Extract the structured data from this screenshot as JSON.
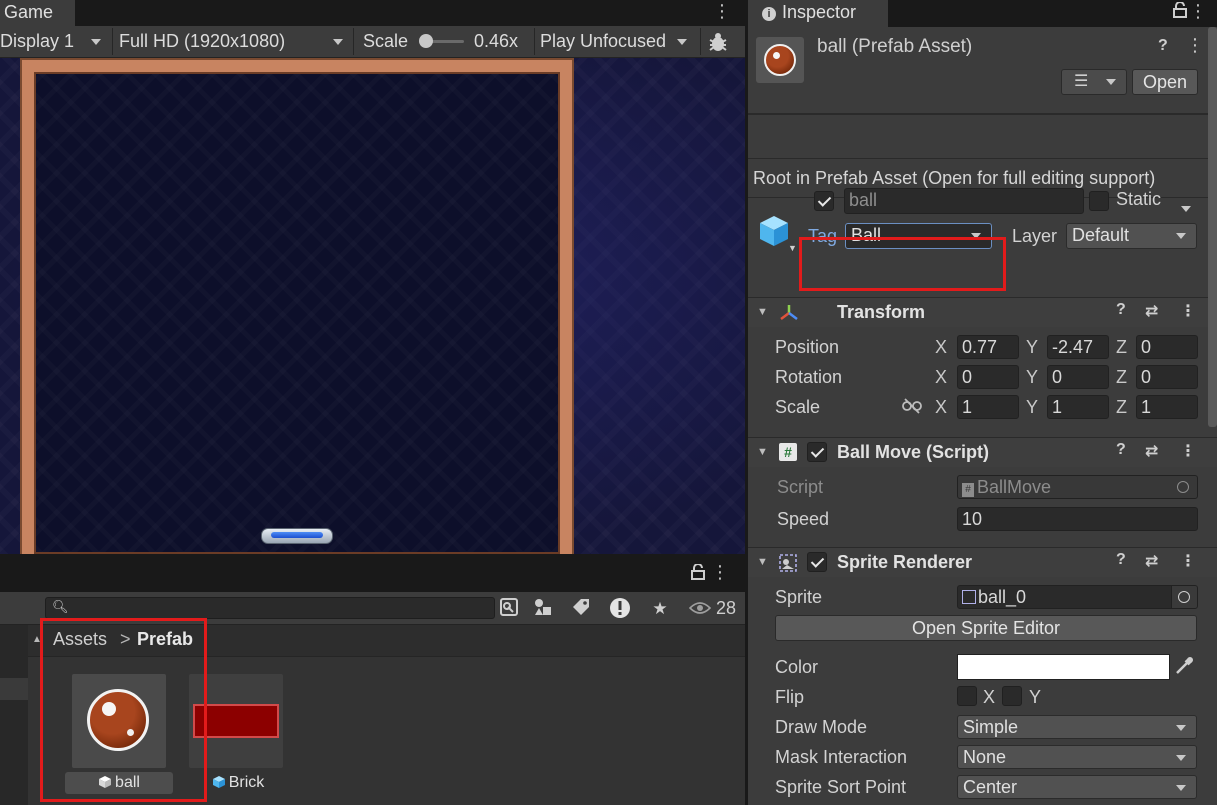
{
  "game": {
    "tab_label": "Game",
    "menu_icon": "kebab-menu-icon",
    "toolbar": {
      "display": "Display 1",
      "resolution": "Full HD (1920x1080)",
      "scale_label": "Scale",
      "scale_value": "0.46x",
      "play_mode": "Play Unfocused",
      "debug_icon": "bug-icon"
    }
  },
  "project": {
    "hidden_count": "28",
    "search_value": "",
    "breadcrumb": {
      "root": "Assets",
      "separator": ">",
      "current": "Prefab"
    },
    "assets": [
      {
        "name": "ball",
        "icon": "prefab-cube-icon"
      },
      {
        "name": "Brick",
        "icon": "prefab-cube-icon"
      }
    ]
  },
  "inspector": {
    "tab_label": "Inspector",
    "asset_title": "ball (Prefab Asset)",
    "open_label": "Open",
    "root_note": "Root in Prefab Asset (Open for full editing support)",
    "gameobject": {
      "active": true,
      "name": "ball",
      "static_label": "Static",
      "static": false,
      "tag_label": "Tag",
      "tag_value": "Ball",
      "layer_label": "Layer",
      "layer_value": "Default"
    },
    "transform": {
      "title": "Transform",
      "position_label": "Position",
      "rotation_label": "Rotation",
      "scale_label": "Scale",
      "axis_x": "X",
      "axis_y": "Y",
      "axis_z": "Z",
      "position": {
        "x": "0.77",
        "y": "-2.47",
        "z": "0"
      },
      "rotation": {
        "x": "0",
        "y": "0",
        "z": "0"
      },
      "scale": {
        "x": "1",
        "y": "1",
        "z": "1"
      }
    },
    "ball_move": {
      "title": "Ball Move (Script)",
      "script_label": "Script",
      "script_value": "BallMove",
      "speed_label": "Speed",
      "speed_value": "10"
    },
    "sprite_renderer": {
      "title": "Sprite Renderer",
      "sprite_label": "Sprite",
      "sprite_value": "ball_0",
      "open_editor_label": "Open Sprite Editor",
      "color_label": "Color",
      "color_value": "#ffffff",
      "flip_label": "Flip",
      "flip_x_label": "X",
      "flip_y_label": "Y",
      "draw_mode_label": "Draw Mode",
      "draw_mode_value": "Simple",
      "mask_label": "Mask Interaction",
      "mask_value": "None",
      "sort_point_label": "Sprite Sort Point",
      "sort_point_value": "Center"
    }
  },
  "colors": {
    "highlight": "#e21b1b",
    "panel": "#3c3c3c",
    "tag_label": "#7fa9e0"
  }
}
